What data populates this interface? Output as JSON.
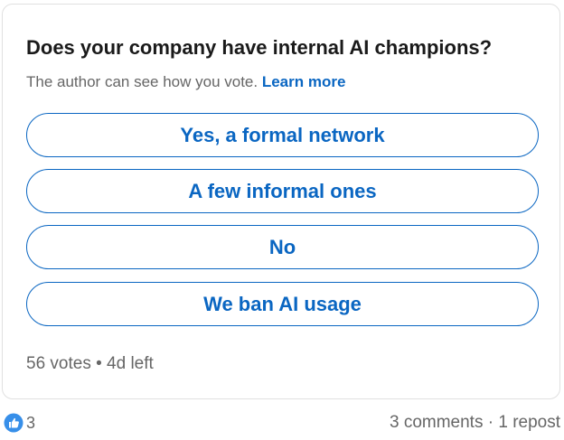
{
  "poll": {
    "question": "Does your company have internal AI champions?",
    "visibility_note": "The author can see how you vote.",
    "learn_more_label": "Learn more",
    "options": [
      {
        "label": "Yes, a formal network"
      },
      {
        "label": "A few informal ones"
      },
      {
        "label": "No"
      },
      {
        "label": "We ban AI usage"
      }
    ],
    "votes": "56 votes",
    "separator": "•",
    "time_left": "4d left"
  },
  "social": {
    "reaction_icon": "like-icon",
    "reaction_count": "3",
    "comments": "3 comments",
    "separator": "·",
    "reposts": "1 repost"
  },
  "colors": {
    "accent": "#0a66c2",
    "muted_text": "#666666",
    "border": "#e0e0e0"
  }
}
